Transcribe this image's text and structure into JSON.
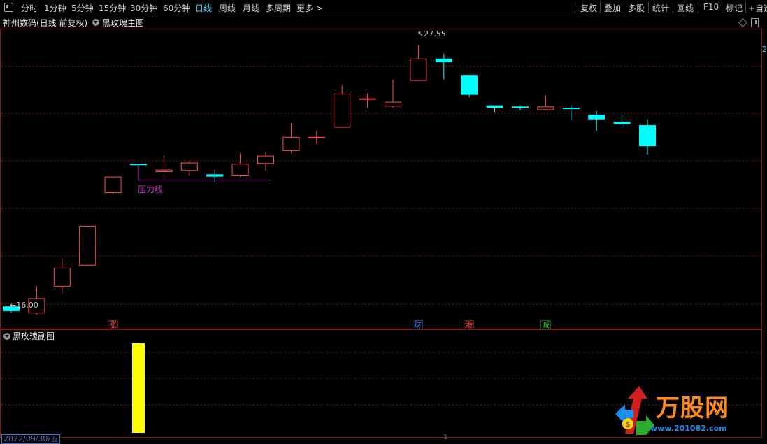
{
  "toolbar": {
    "periods": [
      "分时",
      "1分钟",
      "5分钟",
      "15分钟",
      "30分钟",
      "60分钟",
      "日线",
      "周线",
      "月线",
      "多周期",
      "更多"
    ],
    "active_period": "日线",
    "more_arrow": ">",
    "right_buttons": [
      "复权",
      "叠加",
      "多股",
      "统计",
      "画线",
      "F10",
      "标记",
      "+自选"
    ]
  },
  "main_chart": {
    "stock_title": "神州数码(日线 前复权)",
    "indicator_name": "黑玫瑰主图",
    "right_axis_fragment": "2",
    "high_label": "27.55",
    "low_label": "16.00",
    "annotation_label": "压力线",
    "colors": {
      "up": "#ff4d4d",
      "down": "#00ffff",
      "annotation": "#cc33cc",
      "grid": "#7a1a1a"
    }
  },
  "chart_data": {
    "type": "candlestick",
    "title": "黑玫瑰主图",
    "series": [
      {
        "name": "K线",
        "candles": [
          {
            "o": 16.35,
            "h": 16.45,
            "l": 16.05,
            "c": 16.15
          },
          {
            "o": 16.05,
            "h": 17.2,
            "l": 16.0,
            "c": 16.7
          },
          {
            "o": 17.2,
            "h": 18.4,
            "l": 16.9,
            "c": 18.0
          },
          {
            "o": 18.1,
            "h": 19.8,
            "l": 18.1,
            "c": 19.8
          },
          {
            "o": 21.2,
            "h": 21.9,
            "l": 21.15,
            "c": 21.9
          },
          {
            "o": 22.45,
            "h": 22.45,
            "l": 21.8,
            "c": 22.4
          },
          {
            "o": 22.1,
            "h": 22.8,
            "l": 21.9,
            "c": 22.2
          },
          {
            "o": 22.15,
            "h": 22.6,
            "l": 21.95,
            "c": 22.5
          },
          {
            "o": 22.0,
            "h": 22.2,
            "l": 21.65,
            "c": 21.9
          },
          {
            "o": 21.95,
            "h": 22.9,
            "l": 21.9,
            "c": 22.45
          },
          {
            "o": 22.45,
            "h": 22.95,
            "l": 22.15,
            "c": 22.8
          },
          {
            "o": 23.0,
            "h": 24.2,
            "l": 22.9,
            "c": 23.6
          },
          {
            "o": 23.55,
            "h": 23.85,
            "l": 23.3,
            "c": 23.6
          },
          {
            "o": 24.0,
            "h": 25.8,
            "l": 24.0,
            "c": 25.45
          },
          {
            "o": 25.2,
            "h": 25.45,
            "l": 24.85,
            "c": 25.25
          },
          {
            "o": 24.9,
            "h": 26.05,
            "l": 24.85,
            "c": 25.1
          },
          {
            "o": 26.0,
            "h": 27.55,
            "l": 26.0,
            "c": 26.95
          },
          {
            "o": 26.95,
            "h": 27.15,
            "l": 26.05,
            "c": 26.8
          },
          {
            "o": 26.25,
            "h": 26.25,
            "l": 25.3,
            "c": 25.4
          },
          {
            "o": 24.95,
            "h": 24.95,
            "l": 24.65,
            "c": 24.85
          },
          {
            "o": 24.9,
            "h": 24.95,
            "l": 24.75,
            "c": 24.85
          },
          {
            "o": 24.75,
            "h": 25.35,
            "l": 24.75,
            "c": 24.9
          },
          {
            "o": 24.85,
            "h": 24.95,
            "l": 24.3,
            "c": 24.8
          },
          {
            "o": 24.55,
            "h": 24.7,
            "l": 23.85,
            "c": 24.35
          },
          {
            "o": 24.25,
            "h": 24.55,
            "l": 24.0,
            "c": 24.15
          },
          {
            "o": 24.1,
            "h": 24.35,
            "l": 22.85,
            "c": 23.2
          }
        ]
      }
    ],
    "annotation": {
      "label": "压力线",
      "y": 21.75
    },
    "ylim": [
      15.4,
      28.2
    ],
    "grid": true,
    "event_markers": [
      "涨",
      "财",
      "港",
      "减"
    ]
  },
  "sub_chart": {
    "indicator_name": "黑玫瑰副图",
    "bar_color": "#ffff00",
    "signal_value": 1
  },
  "status": {
    "date": "2022/09/30/五",
    "cursor_mark": "1"
  },
  "watermark": {
    "brand": "万股网",
    "url": "www.201082.com"
  }
}
